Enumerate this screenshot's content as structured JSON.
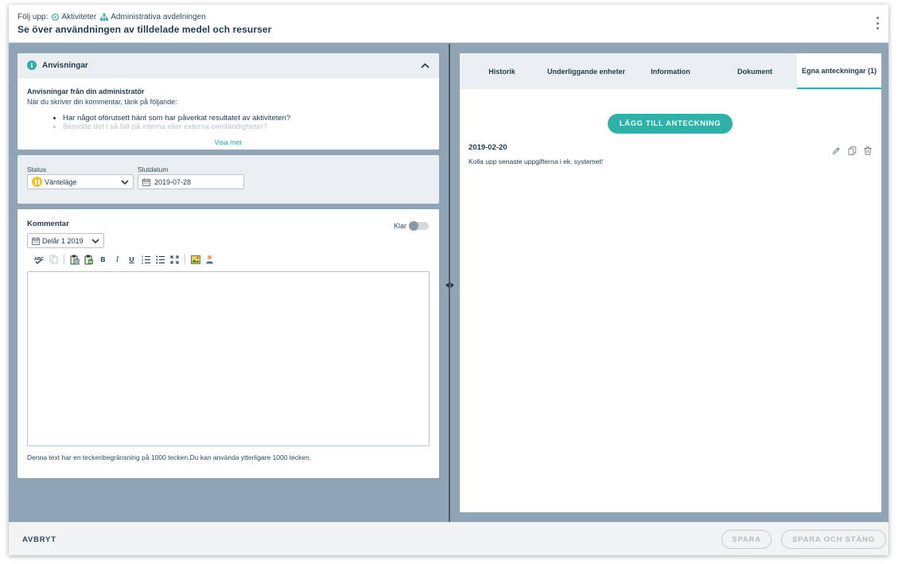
{
  "header": {
    "breadcrumb_prefix": "Följ upp:",
    "breadcrumb_activities": "Aktiviteter",
    "breadcrumb_department": "Administrativa avdelningen",
    "title": "Se över användningen av tilldelade medel och resurser"
  },
  "instructions": {
    "header_label": "Anvisningar",
    "title": "Anvisningar från din administratör",
    "description": "När du skriver din kommentar, tänk på följande:",
    "items": [
      "Har något oförutsett hänt som har påverkat resultatet av aktiviteten?",
      "Berodde det i så fall på interna eller externa omständigheter?"
    ],
    "show_more": "Visa mer"
  },
  "status": {
    "label": "Status",
    "value": "Vänteläge",
    "end_date_label": "Slutdatum",
    "end_date_value": "2019-07-28"
  },
  "comment": {
    "label": "Kommentar",
    "done_label": "Klar",
    "done_checked": false,
    "period": "Delår 1 2019",
    "toolbar": {
      "bold": "B",
      "italic": "I",
      "underline": "U"
    },
    "char_info": "Denna text har en teckenbegränsning på 1000 tecken.Du kan använda ytterligare 1000 tecken."
  },
  "tabs": [
    {
      "label": "Historik",
      "active": false
    },
    {
      "label": "Underliggande enheter",
      "active": false
    },
    {
      "label": "Information",
      "active": false
    },
    {
      "label": "Dokument",
      "active": false
    },
    {
      "label": "Egna anteckningar (1)",
      "active": true
    }
  ],
  "notes": {
    "add_button": "LÄGG TILL ANTECKNING",
    "items": [
      {
        "date": "2019-02-20",
        "text": "Kolla upp senaste uppgifterna i ek. systemet!"
      }
    ]
  },
  "footer": {
    "cancel": "AVBRYT",
    "save": "SPARA",
    "save_close": "SPARA OCH STÄNG"
  },
  "colors": {
    "accent": "#2fb0a8",
    "background": "#8fa4b4",
    "status_paused": "#f3c12a",
    "text_dark": "#1f3a4d"
  }
}
